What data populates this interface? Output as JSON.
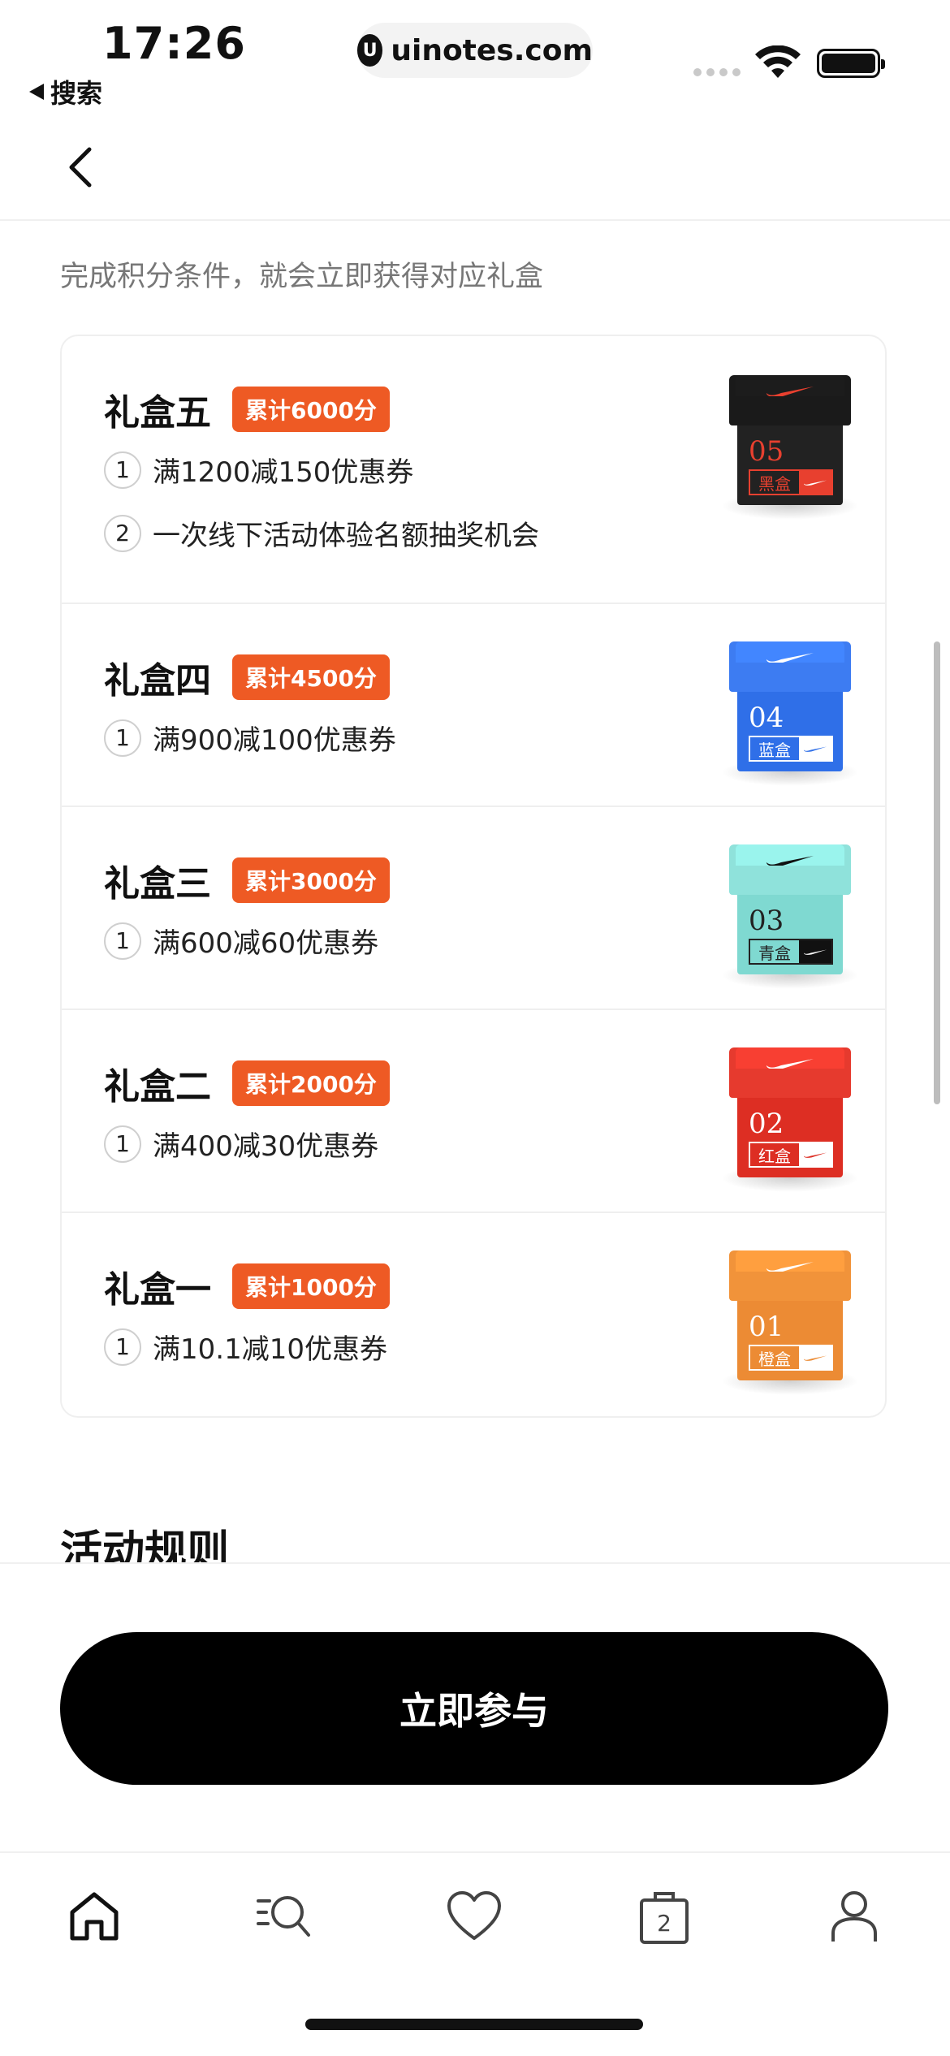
{
  "status_bar": {
    "time": "17:26",
    "back_app_label": "搜索",
    "url": "uinotes.com",
    "url_logo": "U"
  },
  "header": {
    "back_icon": "chevron-left-icon"
  },
  "subtitle": "完成积分条件，就会立即获得对应礼盒",
  "gift_boxes": [
    {
      "title": "礼盒五",
      "points_label": "累计6000分",
      "benefits": [
        {
          "num": "1",
          "text": "满1200减150优惠券"
        },
        {
          "num": "2",
          "text": "一次线下活动体验名额抽奖机会"
        }
      ],
      "box": {
        "number": "05",
        "tag": "黑盒",
        "color": "#222222",
        "lid_color": "#1a1a1a",
        "num_color": "#e8402f",
        "tag_color": "#e8402f",
        "logo_bg": "#e8402f"
      }
    },
    {
      "title": "礼盒四",
      "points_label": "累计4500分",
      "benefits": [
        {
          "num": "1",
          "text": "满900减100优惠券"
        }
      ],
      "box": {
        "number": "04",
        "tag": "蓝盒",
        "color": "#2f6fe8",
        "lid_color": "#3d7cf2",
        "num_color": "#ffffff",
        "tag_color": "#ffffff",
        "logo_bg": "#ffffff"
      }
    },
    {
      "title": "礼盒三",
      "points_label": "累计3000分",
      "benefits": [
        {
          "num": "1",
          "text": "满600减60优惠券"
        }
      ],
      "box": {
        "number": "03",
        "tag": "青盒",
        "color": "#7fd9d1",
        "lid_color": "#8fe2db",
        "num_color": "#222222",
        "tag_color": "#222222",
        "logo_bg": "#111111"
      }
    },
    {
      "title": "礼盒二",
      "points_label": "累计2000分",
      "benefits": [
        {
          "num": "1",
          "text": "满400减30优惠券"
        }
      ],
      "box": {
        "number": "02",
        "tag": "红盒",
        "color": "#dd2e23",
        "lid_color": "#e63a2e",
        "num_color": "#ffffff",
        "tag_color": "#ffffff",
        "logo_bg": "#ffffff"
      }
    },
    {
      "title": "礼盒一",
      "points_label": "累计1000分",
      "benefits": [
        {
          "num": "1",
          "text": "满10.1减10优惠券"
        }
      ],
      "box": {
        "number": "01",
        "tag": "橙盒",
        "color": "#ec8b34",
        "lid_color": "#f1933a",
        "num_color": "#ffffff",
        "tag_color": "#ffffff",
        "logo_bg": "#ffffff"
      }
    }
  ],
  "section_title": "活动规则",
  "cta_label": "立即参与",
  "tabs": [
    {
      "name": "home-icon"
    },
    {
      "name": "search-list-icon"
    },
    {
      "name": "heart-icon"
    },
    {
      "name": "bag-icon",
      "badge": "2"
    },
    {
      "name": "profile-icon"
    }
  ],
  "colors": {
    "accent": "#ee5a24",
    "cta": "#000000"
  }
}
